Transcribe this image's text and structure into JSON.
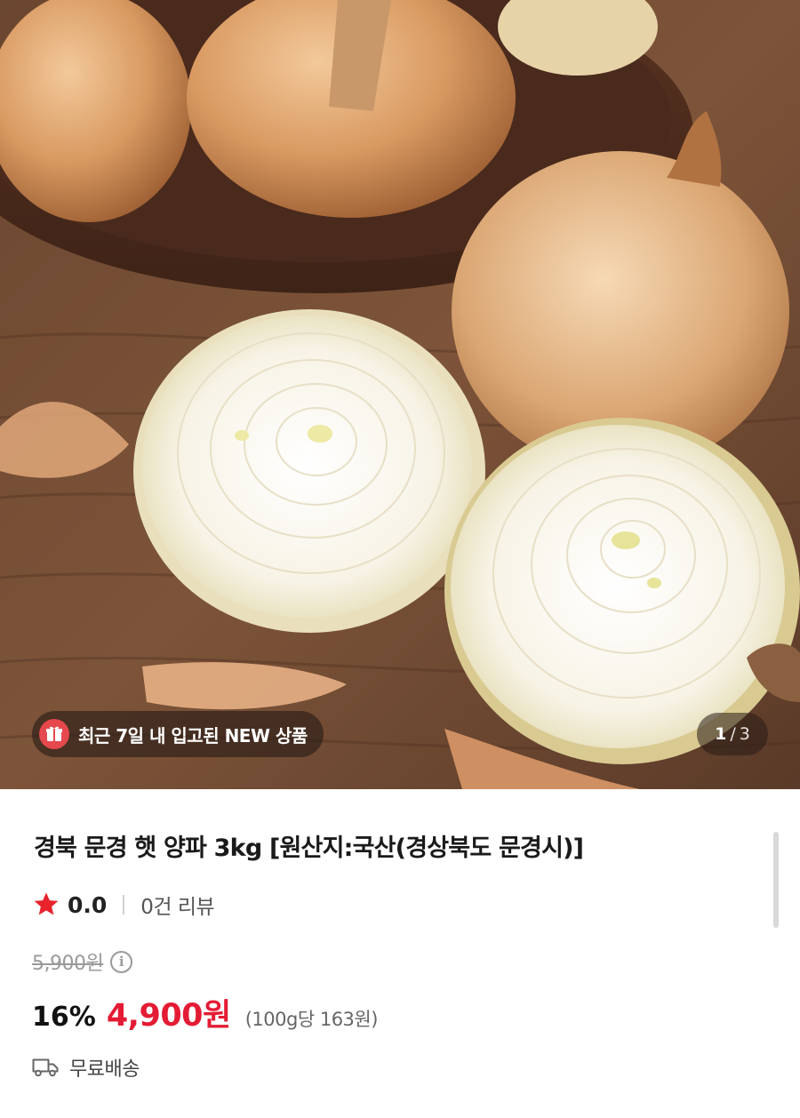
{
  "hero": {
    "badge_icon": "gift-box-icon",
    "badge_text": "최근 7일 내 입고된 NEW 상품",
    "pager": {
      "current": "1",
      "separator": "/",
      "total": "3"
    }
  },
  "product": {
    "title": "경북 문경 햇 양파 3kg [원산지:국산(경상북도 문경시)]",
    "rating": {
      "icon": "star-icon",
      "score": "0.0",
      "review_count": "0건 리뷰"
    },
    "original_price": "5,900원",
    "info_icon_glyph": "i",
    "discount_rate": "16%",
    "sale_price": "4,900원",
    "unit_price": "(100g당 163원)",
    "shipping": {
      "icon": "truck-icon",
      "label": "무료배송"
    }
  },
  "colors": {
    "sale_price": "#e41b34",
    "badge_icon_bg": "#e5484d",
    "star": "#e8232c"
  }
}
